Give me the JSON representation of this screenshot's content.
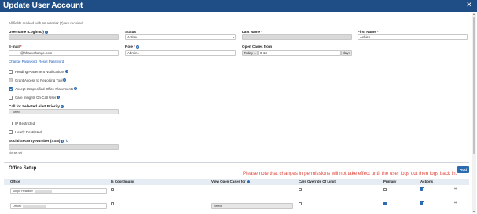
{
  "window": {
    "title": "Update User Account",
    "close_glyph": "✕"
  },
  "form": {
    "required_note": "All fields marked with an asterisk (*) are required",
    "username": {
      "label": "Username (Login ID)",
      "value": ""
    },
    "status": {
      "label": "Status",
      "value": "Active"
    },
    "last_name": {
      "label": "Last Name",
      "value": ""
    },
    "first_name": {
      "label": "First Name",
      "value": "Ashish"
    },
    "email": {
      "label": "E-mail",
      "value": "@hhaexchange.com"
    },
    "role": {
      "label": "Role",
      "value": "Admin1"
    },
    "open_cases_from": {
      "label": "Open Cases from",
      "today_label": "Today ±",
      "value": "0-13",
      "unit": "days"
    },
    "change_password_link": "Change Password",
    "reset_password_link": "Reset Password",
    "checkboxes": [
      {
        "label": "Pending Placement Notifications",
        "checked": false,
        "disabled": false,
        "info": true
      },
      {
        "label": "Grant Access to Reporting Tool",
        "checked": false,
        "disabled": true,
        "info": true
      },
      {
        "label": "Accept Unspecified Office Placements",
        "checked": true,
        "disabled": false,
        "info": true
      },
      {
        "label": "Care Insights On-Call User",
        "checked": false,
        "disabled": false,
        "info": true
      }
    ],
    "alert_priority": {
      "label": "Call for Selected Alert Priority",
      "value": "Select"
    },
    "ip_restricted": {
      "label": "IP Restricted",
      "checked": false
    },
    "hourly_restricted": {
      "label": "Hourly Restricted",
      "checked": false
    },
    "ssn": {
      "label": "Social Security Number (SSN)",
      "value": "",
      "hint": "Not set yet"
    }
  },
  "office_setup": {
    "title": "Office Setup",
    "notice": "Please note that changes in permissions will not take effect until the user logs out then logs back in.",
    "add_label": "Add",
    "columns": [
      "Office",
      "Is Coordinator",
      "View Open Cases for",
      "Care Override Of Limit",
      "Primary",
      "Actions"
    ],
    "rows": [
      {
        "office": "Sceph Headster",
        "is_coordinator": false,
        "view_open_cases": "",
        "care_override": false,
        "primary": false
      },
      {
        "office": "Office2",
        "is_coordinator": false,
        "view_open_cases": "Select",
        "care_override": false,
        "primary": true
      }
    ]
  },
  "icons": {
    "info": "info-icon",
    "refresh": "refresh-icon",
    "trash": "trash-icon",
    "expand": "expand-icon"
  },
  "colors": {
    "title_bar": "#1f4e87",
    "accent": "#2b6cb0",
    "notice": "#e0453a"
  }
}
